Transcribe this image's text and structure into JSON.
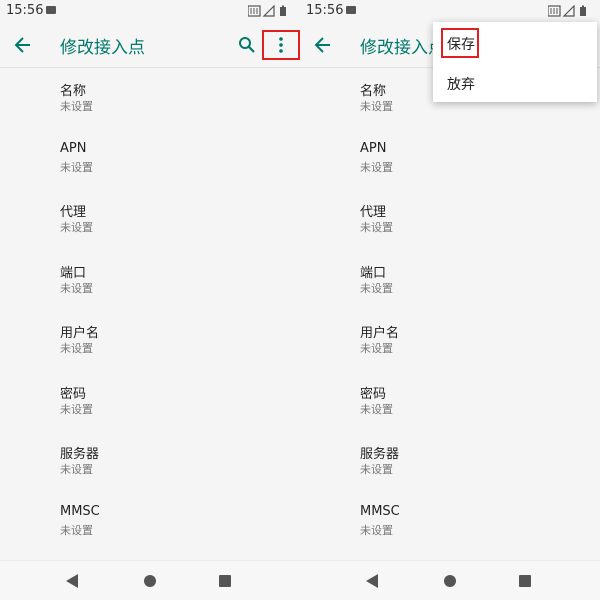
{
  "left": {
    "status": {
      "time": "15:56"
    },
    "appbar": {
      "title": "修改接入点",
      "back_icon": "arrow-left-icon",
      "search_icon": "search-icon",
      "overflow_icon": "more-vert-icon"
    },
    "items": [
      {
        "label": "名称",
        "value": "未设置"
      },
      {
        "label": "APN",
        "value": "未设置"
      },
      {
        "label": "代理",
        "value": "未设置"
      },
      {
        "label": "端口",
        "value": "未设置"
      },
      {
        "label": "用户名",
        "value": "未设置"
      },
      {
        "label": "密码",
        "value": "未设置"
      },
      {
        "label": "服务器",
        "value": "未设置"
      },
      {
        "label": "MMSC",
        "value": "未设置"
      }
    ]
  },
  "right": {
    "status": {
      "time": "15:56"
    },
    "appbar": {
      "title": "修改接入点",
      "back_icon": "arrow-left-icon"
    },
    "menu": [
      {
        "label": "保存"
      },
      {
        "label": "放弃"
      }
    ],
    "items": [
      {
        "label": "名称",
        "value": "未设置"
      },
      {
        "label": "APN",
        "value": "未设置"
      },
      {
        "label": "代理",
        "value": "未设置"
      },
      {
        "label": "端口",
        "value": "未设置"
      },
      {
        "label": "用户名",
        "value": "未设置"
      },
      {
        "label": "密码",
        "value": "未设置"
      },
      {
        "label": "服务器",
        "value": "未设置"
      },
      {
        "label": "MMSC",
        "value": "未设置"
      }
    ]
  },
  "colors": {
    "accent": "#00796b",
    "highlight": "#e02020",
    "background": "#f5f5f5"
  }
}
